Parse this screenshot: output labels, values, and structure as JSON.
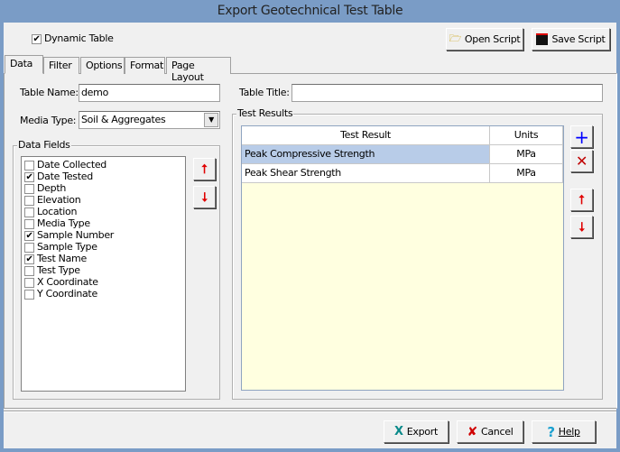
{
  "window": {
    "title": "Export Geotechnical Test Table"
  },
  "dynamic_table": {
    "label": "Dynamic Table",
    "checked": true
  },
  "toolbar": {
    "open_script": "Open Script",
    "save_script": "Save Script"
  },
  "tabs": [
    {
      "label": "Data",
      "active": true
    },
    {
      "label": "Filter"
    },
    {
      "label": "Options"
    },
    {
      "label": "Format"
    },
    {
      "label": "Page Layout"
    }
  ],
  "form": {
    "table_name_label": "Table Name:",
    "table_name": "demo",
    "media_type_label": "Media Type:",
    "media_type": "Soil & Aggregates",
    "table_title_label": "Table Title:",
    "table_title": ""
  },
  "data_fields": {
    "label": "Data Fields",
    "items": [
      {
        "label": "Date Collected",
        "checked": false
      },
      {
        "label": "Date Tested",
        "checked": true
      },
      {
        "label": "Depth",
        "checked": false
      },
      {
        "label": "Elevation",
        "checked": false
      },
      {
        "label": "Location",
        "checked": false
      },
      {
        "label": "Media Type",
        "checked": false
      },
      {
        "label": "Sample Number",
        "checked": true
      },
      {
        "label": "Sample Type",
        "checked": false
      },
      {
        "label": "Test Name",
        "checked": true
      },
      {
        "label": "Test Type",
        "checked": false
      },
      {
        "label": "X Coordinate",
        "checked": false
      },
      {
        "label": "Y Coordinate",
        "checked": false
      }
    ]
  },
  "test_results": {
    "label": "Test Results",
    "columns": [
      "Test Result",
      "Units"
    ],
    "rows": [
      {
        "result": "Peak Compressive Strength",
        "units": "MPa",
        "selected": true
      },
      {
        "result": "Peak Shear Strength",
        "units": "MPa",
        "selected": false
      }
    ]
  },
  "footer": {
    "export": "Export",
    "cancel": "Cancel",
    "help": "Help"
  },
  "colors": {
    "titlebar": "#7a9cc6",
    "selected_row": "#b8cce8",
    "grid_bg": "#ffffe0",
    "arrow": "#e00000",
    "add": "#0000ff"
  }
}
